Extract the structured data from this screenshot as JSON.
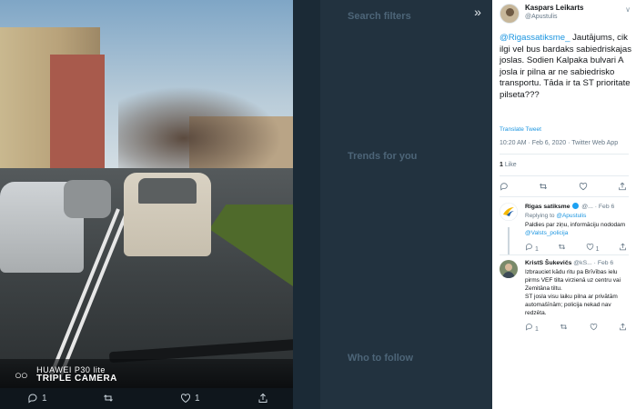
{
  "photo": {
    "watermark_line1": "HUAWEI P30 lite",
    "watermark_line2": "TRIPLE CAMERA",
    "actions": {
      "reply_count": "1",
      "like_count": "1"
    }
  },
  "background": {
    "search_filters": "Search filters",
    "trends": "Trends for you",
    "who_to_follow": "Who to follow"
  },
  "tweet": {
    "author_name": "Kaspars Leikarts",
    "author_handle": "@Apustulis",
    "mention": "@Rigassatiksme_",
    "text": "Jautājums, cik ilgi vel bus bardaks sabiedriskajas joslas. Sodien Kalpaka bulvari A josla ir pilna ar ne sabiedrisko transportu. Tāda ir ta ST prioritate pilseta???",
    "translate_label": "Translate Tweet",
    "timestamp": "10:20 AM · Feb 6, 2020 · Twitter Web App",
    "like_count": "1",
    "like_label": "Like"
  },
  "replies": [
    {
      "name": "Rigas satiksme",
      "handle": "@...",
      "date": "· Feb 6",
      "replying_to_label": "Replying to",
      "replying_to_handle": "@Apustulis",
      "text_pre": "Paldies par ziņu, informāciju nododam ",
      "text_mention": "@Valsts_policija",
      "reply_count": "1",
      "retweet_count": "",
      "like_count": "1"
    },
    {
      "name": "KristS Šukevičs",
      "handle": "@kS...",
      "date": "· Feb 6",
      "text": "Izbrauciet kādu ritu pa Brīvības ielu pirms VEF tilta virzienā uz centru vai Zemitāna tiltu.\nST josla visu laiku pilna ar privātām automašīnām; policija nekad nav redzēta.",
      "reply_count": "1",
      "retweet_count": "",
      "like_count": ""
    }
  ]
}
